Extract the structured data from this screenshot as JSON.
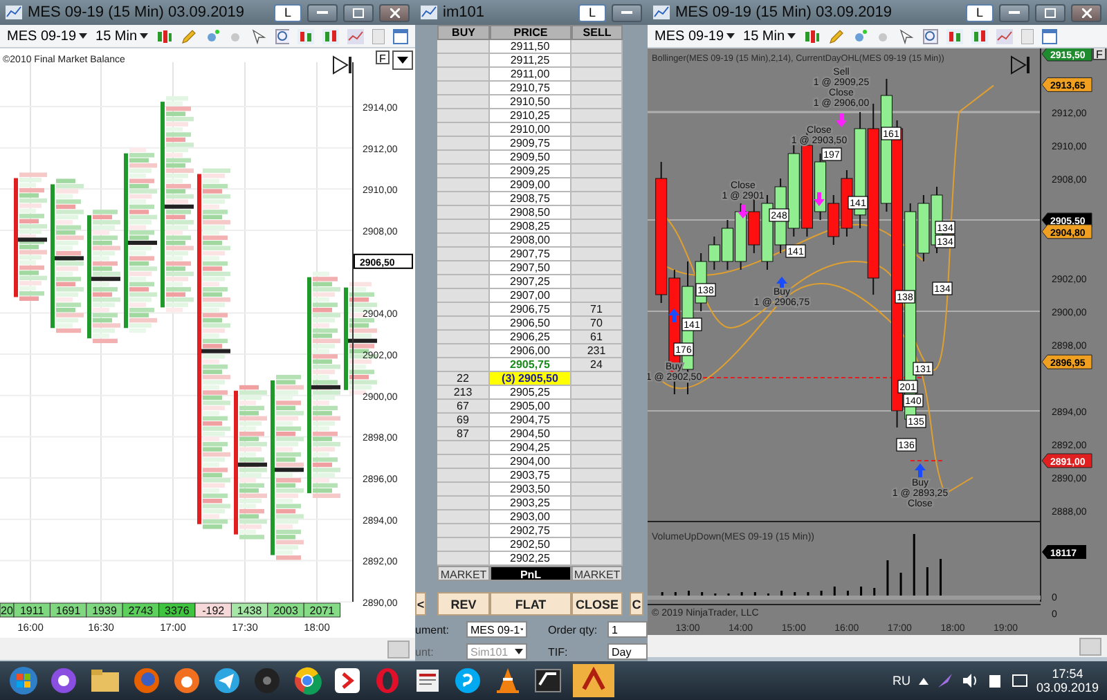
{
  "left_window": {
    "title": "MES 09-19 (15 Min)  03.09.2019",
    "badge": "L",
    "toolbar": {
      "instrument": "MES 09-19",
      "interval": "15 Min"
    },
    "indicator": "©2010 Final Market Balance",
    "flag": "F",
    "price_ticks": [
      "2914,00",
      "2912,00",
      "2910,00",
      "2908,00",
      "2904,00",
      "2902,00",
      "2900,00",
      "2898,00",
      "2896,00",
      "2894,00",
      "2892,00",
      "2890,00"
    ],
    "price_tag": "2906,50",
    "deltas": [
      {
        "text": "20",
        "color": "#7fd87f"
      },
      {
        "text": "1911",
        "color": "#7fd87f"
      },
      {
        "text": "1691",
        "color": "#7fd87f"
      },
      {
        "text": "1939",
        "color": "#7fd87f"
      },
      {
        "text": "2743",
        "color": "#5ccf5c"
      },
      {
        "text": "3376",
        "color": "#3fc43f"
      },
      {
        "text": "-192",
        "color": "#f6d8d8"
      },
      {
        "text": "1438",
        "color": "#a6e6a6"
      },
      {
        "text": "2003",
        "color": "#86dc86"
      },
      {
        "text": "2071",
        "color": "#86dc86"
      }
    ],
    "times": [
      "16:00",
      "16:30",
      "17:00",
      "17:30",
      "18:00"
    ]
  },
  "dom": {
    "title": "im101",
    "badge": "L",
    "columns": [
      "BUY",
      "PRICE",
      "SELL"
    ],
    "rows": [
      {
        "price": "2911,50",
        "kind": "normal"
      },
      {
        "price": "2911,25",
        "kind": "normal"
      },
      {
        "price": "2911,00",
        "kind": "normal"
      },
      {
        "price": "2910,75",
        "kind": "normal"
      },
      {
        "price": "2910,50",
        "kind": "normal"
      },
      {
        "price": "2910,25",
        "kind": "normal"
      },
      {
        "price": "2910,00",
        "kind": "normal"
      },
      {
        "price": "2909,75",
        "kind": "normal"
      },
      {
        "price": "2909,50",
        "kind": "normal"
      },
      {
        "price": "2909,25",
        "kind": "normal"
      },
      {
        "price": "2909,00",
        "kind": "normal"
      },
      {
        "price": "2908,75",
        "kind": "normal"
      },
      {
        "price": "2908,50",
        "kind": "normal"
      },
      {
        "price": "2908,25",
        "kind": "normal"
      },
      {
        "price": "2908,00",
        "kind": "normal"
      },
      {
        "price": "2907,75",
        "kind": "normal"
      },
      {
        "price": "2907,50",
        "kind": "normal"
      },
      {
        "price": "2907,25",
        "kind": "normal"
      },
      {
        "price": "2907,00",
        "kind": "normal"
      },
      {
        "price": "2906,75",
        "sell": "71",
        "kind": "normal"
      },
      {
        "price": "2906,50",
        "sell": "70",
        "kind": "normal"
      },
      {
        "price": "2906,25",
        "sell": "61",
        "kind": "normal"
      },
      {
        "price": "2906,00",
        "sell": "231",
        "kind": "normal"
      },
      {
        "price": "2905,75",
        "sell": "24",
        "kind": "last"
      },
      {
        "buy": "22",
        "price": "(3) 2905,50",
        "kind": "position"
      },
      {
        "buy": "213",
        "price": "2905,25",
        "kind": "normal"
      },
      {
        "buy": "67",
        "price": "2905,00",
        "kind": "normal"
      },
      {
        "buy": "69",
        "price": "2904,75",
        "kind": "normal"
      },
      {
        "buy": "87",
        "price": "2904,50",
        "kind": "normal"
      },
      {
        "price": "2904,25",
        "kind": "normal"
      },
      {
        "price": "2904,00",
        "kind": "normal"
      },
      {
        "price": "2903,75",
        "kind": "normal"
      },
      {
        "price": "2903,50",
        "kind": "normal"
      },
      {
        "price": "2903,25",
        "kind": "normal"
      },
      {
        "price": "2903,00",
        "kind": "normal"
      },
      {
        "price": "2902,75",
        "kind": "normal"
      },
      {
        "price": "2902,50",
        "kind": "normal"
      },
      {
        "price": "2902,25",
        "kind": "normal"
      }
    ],
    "footer": [
      "MARKET",
      "PnL",
      "MARKET"
    ],
    "buttons": [
      "<",
      "REV",
      "FLAT",
      "CLOSE",
      "C"
    ],
    "fields": [
      {
        "label": "ument:",
        "value": "MES 09-1",
        "disabled": false,
        "label2": "Order qty:",
        "value2": "1"
      },
      {
        "label": "unt:",
        "value": "Sim101",
        "disabled": true,
        "label2": "TIF:",
        "value2": "Day"
      }
    ]
  },
  "right_window": {
    "title": "MES 09-19 (15 Min)  03.09.2019",
    "badge": "L",
    "toolbar": {
      "instrument": "MES 09-19",
      "interval": "15 Min"
    },
    "indicator": "Bollinger(MES 09-19 (15 Min),2,14), CurrentDayOHL(MES 09-19 (15 Min))",
    "flag": "F",
    "price_ticks": [
      "2912,00",
      "2910,00",
      "2908,00",
      "2902,00",
      "2900,00",
      "2898,00",
      "2894,00",
      "2892,00",
      "2890,00",
      "2888,00"
    ],
    "price_tags": [
      {
        "text": "2915,50",
        "color": "#1e8c2e"
      },
      {
        "text": "2913,65",
        "color": "#f0a020"
      },
      {
        "text": "2905,50",
        "color": "#000000"
      },
      {
        "text": "2904,80",
        "color": "#f0a020"
      },
      {
        "text": "2896,95",
        "color": "#f0a020"
      },
      {
        "text": "2891,00",
        "color": "#e02020"
      }
    ],
    "annotations": [
      {
        "lines": [
          "Sell",
          "1 @ 2909,25",
          "Close",
          "1 @ 2906,00"
        ]
      },
      {
        "lines": [
          "Close",
          "1 @ 2903,50"
        ]
      },
      {
        "lines": [
          "Close",
          "1 @ 2901"
        ]
      },
      {
        "lines": [
          "Buy",
          "1 @ 2906,75"
        ]
      },
      {
        "lines": [
          "Buy",
          "1 @ 2902,50"
        ]
      },
      {
        "lines": [
          "Buy",
          "1 @ 2893,25",
          "Close"
        ]
      }
    ],
    "box_labels": [
      "197",
      "161",
      "248",
      "141",
      "141",
      "138",
      "141",
      "176",
      "134",
      "134",
      "138",
      "134",
      "201",
      "131",
      "140",
      "135",
      "136"
    ],
    "volume": {
      "title": "VolumeUpDown(MES 09-19 (15 Min))",
      "tag": "18117",
      "zeros": [
        "0",
        "0"
      ]
    },
    "copyright": "© 2019 NinjaTrader, LLC",
    "times": [
      "13:00",
      "14:00",
      "15:00",
      "16:00",
      "17:00",
      "18:00",
      "19:00"
    ]
  },
  "taskbar": {
    "language": "RU",
    "time": "17:54",
    "date": "03.09.2019"
  }
}
